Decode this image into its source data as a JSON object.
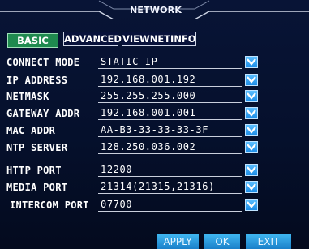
{
  "window": {
    "title": "NETWORK"
  },
  "tabs": [
    {
      "label": "BASIC",
      "active": true
    },
    {
      "label": "ADVANCED",
      "active": false
    },
    {
      "label": "VIEWNETINFO",
      "active": false
    }
  ],
  "fields": [
    {
      "label": "CONNECT MODE",
      "value": "STATIC IP"
    },
    {
      "label": "IP ADDRESS",
      "value": "192.168.001.192"
    },
    {
      "label": "NETMASK",
      "value": "255.255.255.000"
    },
    {
      "label": "GATEWAY ADDR",
      "value": "192.168.001.001"
    },
    {
      "label": "MAC ADDR",
      "value": "AA-B3-33-33-33-3F"
    },
    {
      "label": "NTP SERVER",
      "value": "128.250.036.002"
    },
    {
      "label": "HTTP PORT",
      "value": "12200"
    },
    {
      "label": "MEDIA PORT",
      "value": "21314(21315,21316)"
    },
    {
      "label": "INTERCOM PORT",
      "value": "07700"
    }
  ],
  "buttons": {
    "apply": "APPLY",
    "ok": "OK",
    "exit": "EXIT"
  },
  "icons": {
    "dropdown": "chevron-down-icon"
  },
  "colors": {
    "background": "#05102c",
    "active_tab": "#1f8a4f",
    "dropdown": "#2a9cf0",
    "button": "#2a96dc"
  }
}
